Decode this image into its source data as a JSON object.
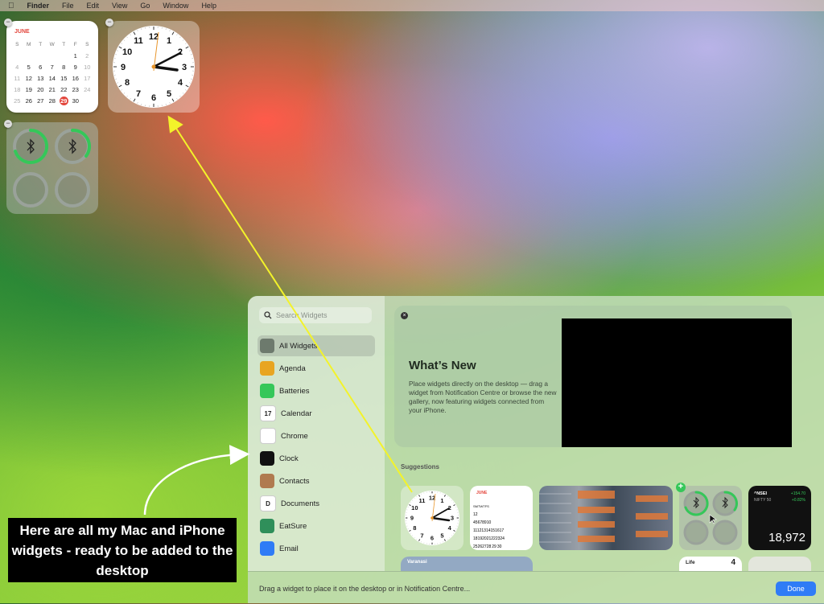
{
  "menubar": {
    "apple": "",
    "app": "Finder",
    "items": [
      "File",
      "Edit",
      "View",
      "Go",
      "Window",
      "Help"
    ]
  },
  "desktop": {
    "calendar": {
      "month": "JUNE",
      "weekdays": [
        "S",
        "M",
        "T",
        "W",
        "T",
        "F",
        "S"
      ],
      "rows": [
        [
          "",
          "",
          "",
          "",
          "",
          "1",
          "2"
        ],
        [
          "4",
          "5",
          "6",
          "7",
          "8",
          "9",
          "10"
        ],
        [
          "11",
          "12",
          "13",
          "14",
          "15",
          "16",
          "17"
        ],
        [
          "18",
          "19",
          "20",
          "21",
          "22",
          "23",
          "24"
        ],
        [
          "25",
          "26",
          "27",
          "28",
          "29",
          "30",
          ""
        ]
      ],
      "today": "29"
    },
    "clock_numbers": [
      "12",
      "1",
      "2",
      "3",
      "4",
      "5",
      "6",
      "7",
      "8",
      "9",
      "10",
      "11"
    ]
  },
  "gallery": {
    "search_placeholder": "Search Widgets",
    "sidebar": [
      {
        "label": "All Widgets",
        "icon": "all-widgets-icon",
        "color": "#6d7a6d"
      },
      {
        "label": "Agenda",
        "icon": "agenda-icon",
        "color": "#e8a521"
      },
      {
        "label": "Batteries",
        "icon": "batteries-icon",
        "color": "#35c759"
      },
      {
        "label": "Calendar",
        "icon": "calendar-icon",
        "color": "#ffffff",
        "glyph": "17"
      },
      {
        "label": "Chrome",
        "icon": "chrome-icon",
        "color": "#ffffff"
      },
      {
        "label": "Clock",
        "icon": "clock-icon",
        "color": "#111111"
      },
      {
        "label": "Contacts",
        "icon": "contacts-icon",
        "color": "#b07a4f"
      },
      {
        "label": "Documents",
        "icon": "documents-icon",
        "color": "#ffffff",
        "glyph": "D"
      },
      {
        "label": "EatSure",
        "icon": "eatsure-icon",
        "color": "#2f8f5a"
      },
      {
        "label": "Email",
        "icon": "email-icon",
        "color": "#2f7cf6"
      }
    ],
    "whats_new": {
      "title": "What’s New",
      "text": "Place widgets directly on the desktop — drag a widget from Notification Centre or browse the new gallery, now featuring widgets connected from your iPhone."
    },
    "suggestions_label": "Suggestions",
    "stock": {
      "symbol": "^NSEI",
      "name": "NIFTY 50",
      "change": "+154.70",
      "change_pct": "+0.82%",
      "value": "18,972"
    },
    "weather_city": "Varanasi",
    "life_label": "Life",
    "life_count": "4",
    "mini_cal_month": "JUNE",
    "footer_text": "Drag a widget to place it on the desktop or in Notification Centre...",
    "done_label": "Done"
  },
  "caption": "Here are all my Mac and iPhone widgets - ready to be added to the desktop",
  "colors": {
    "accent": "#2f7cf6",
    "calendar_red": "#e3463c",
    "battery_green": "#35c759",
    "arrow_yellow": "#f3f32a"
  }
}
